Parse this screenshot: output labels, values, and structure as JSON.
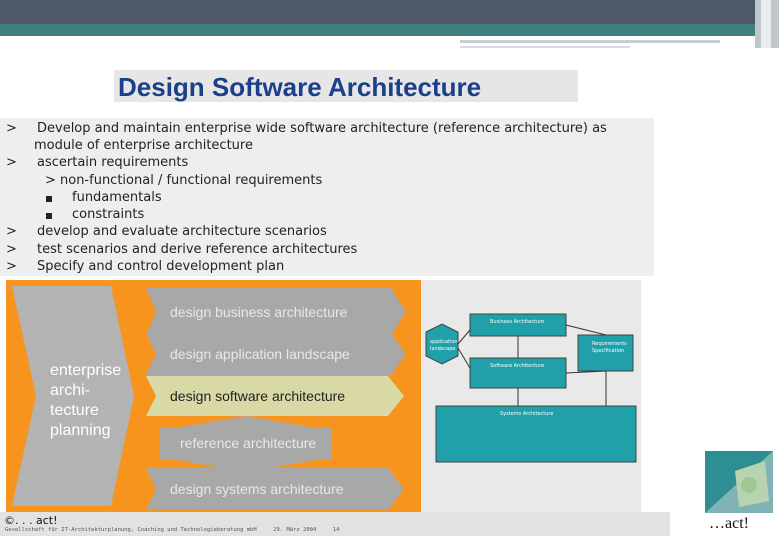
{
  "slide": {
    "title": "Design Software Architecture",
    "bullets": [
      {
        "marker": ">",
        "lines": [
          "Develop and maintain enterprise wide software architecture (reference architecture) as",
          "module of enterprise architecture"
        ]
      },
      {
        "marker": ">",
        "lines": [
          "ascertain requirements"
        ]
      },
      {
        "sub_marker": ">",
        "lines": [
          "non-functional / functional requirements"
        ]
      },
      {
        "sub_square": true,
        "lines": [
          "fundamentals"
        ]
      },
      {
        "sub_square": true,
        "lines": [
          "constraints"
        ]
      },
      {
        "marker": ">",
        "lines": [
          "develop and evaluate architecture scenarios"
        ]
      },
      {
        "marker": ">",
        "lines": [
          "test scenarios and derive reference architectures"
        ]
      },
      {
        "marker": ">",
        "lines": [
          "Specify and control development plan"
        ]
      }
    ]
  },
  "diagram": {
    "big_arrow_lines": [
      "enterprise",
      "archi-",
      "tecture",
      "planning"
    ],
    "steps": [
      {
        "label": "design business architecture",
        "highlight": false
      },
      {
        "label": "design application landscape",
        "highlight": false
      },
      {
        "label": "design software architecture",
        "highlight": true
      },
      {
        "label": "reference architecture",
        "highlight": false
      },
      {
        "label": "design systems architecture",
        "highlight": false
      }
    ],
    "boxes": {
      "business": "Business Architecture",
      "requirements_1": "Requirements",
      "requirements_2": "Specification",
      "application_1": "application",
      "application_2": "landscape",
      "software": "Software Architecture",
      "systems": "Systems Architecture"
    },
    "colors": {
      "orange": "#f7941d",
      "grey_bar": "#a8a8a8",
      "highlight": "#d9d9a6",
      "teal": "#20a0a8"
    }
  },
  "footer": {
    "copyright": "©. . . act!",
    "company": "Gesellschaft für IT-Architekturplanung, Coaching und Technologieberatung mbH",
    "date": "29. März 2004",
    "page": "14"
  },
  "logo": {
    "text": "…act!"
  }
}
